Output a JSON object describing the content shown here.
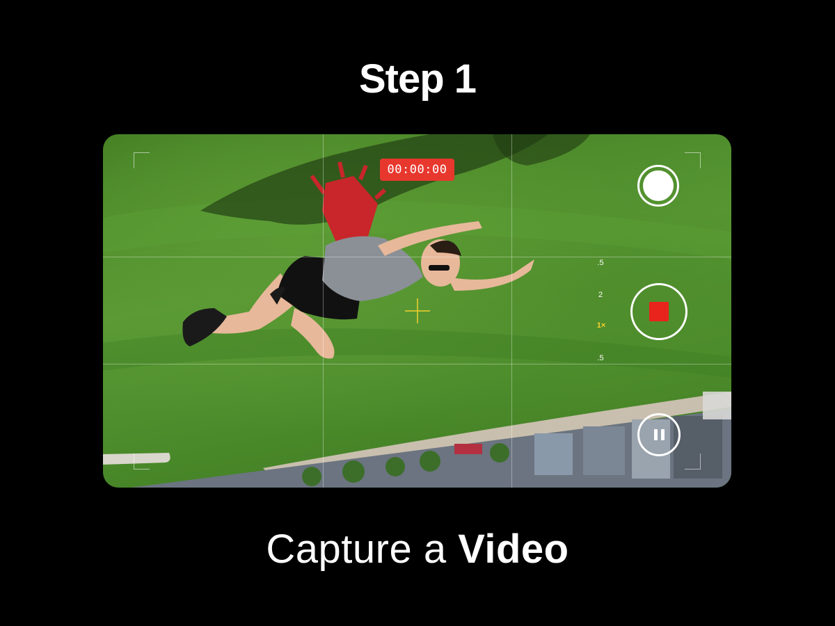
{
  "header": {
    "title": "Step 1"
  },
  "caption": {
    "prefix": "Capture a",
    "emphasis": "Video"
  },
  "camera": {
    "timer": "00:00:00",
    "zoom_levels": [
      ".5",
      "2",
      "1×",
      ".5"
    ],
    "active_zoom": "1×",
    "icons": {
      "shutter": "photo-shutter-icon",
      "record": "stop-record-icon",
      "pause": "pause-icon",
      "focus": "focus-crosshair-icon"
    },
    "colors": {
      "record_red": "#e8241c",
      "timer_bg": "#e8382e",
      "focus_yellow": "#f5d030",
      "grass": "#4a8a2a"
    }
  }
}
